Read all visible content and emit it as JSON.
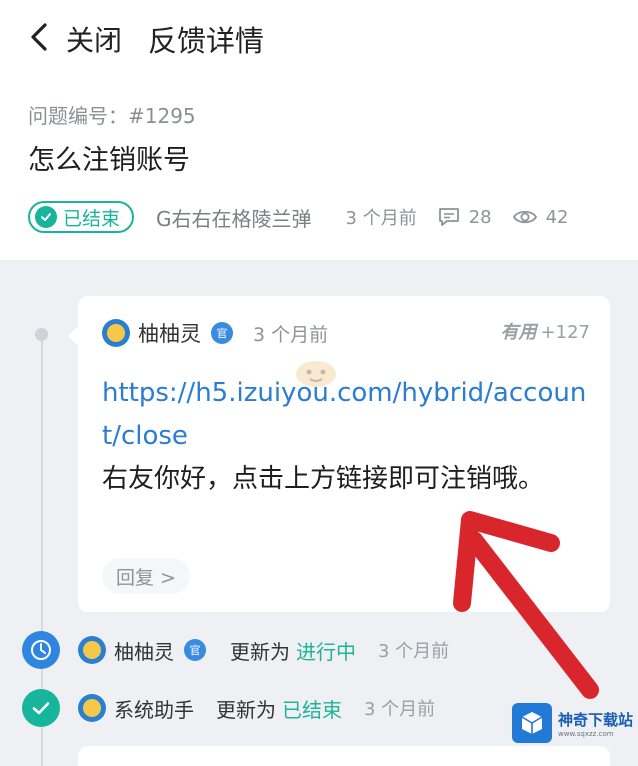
{
  "header": {
    "close_label": "关闭",
    "title": "反馈详情"
  },
  "question": {
    "number": "问题编号：#1295",
    "title": "怎么注销账号",
    "status": "已结束",
    "asker": "G右右在格陵兰弹",
    "time": "3 个月前",
    "comments": "28",
    "views": "42"
  },
  "answer": {
    "author": "柚柚灵",
    "official_badge": "官",
    "time": "3 个月前",
    "useful_label": "有用",
    "useful_count": "+127",
    "link": "https://h5.izuiyou.com/hybrid/account/close",
    "text": "右友你好，点击上方链接即可注销哦。",
    "reply_label": "回复 >"
  },
  "events": [
    {
      "name": "柚柚灵",
      "official_badge": "官",
      "verb": "更新为",
      "status": "进行中",
      "time": "3 个月前",
      "status_color": "#1fb49a"
    },
    {
      "name": "系统助手",
      "verb": "更新为",
      "status": "已结束",
      "time": "3 个月前",
      "status_color": "#1fb49a"
    }
  ],
  "watermark": {
    "site_name": "神奇下载站",
    "site_url": "www.sqxzz.com"
  },
  "colors": {
    "accent": "#17b59b",
    "link": "#2b7cd3",
    "arrow": "#d9262c",
    "clock_icon": "#2f86e0"
  }
}
